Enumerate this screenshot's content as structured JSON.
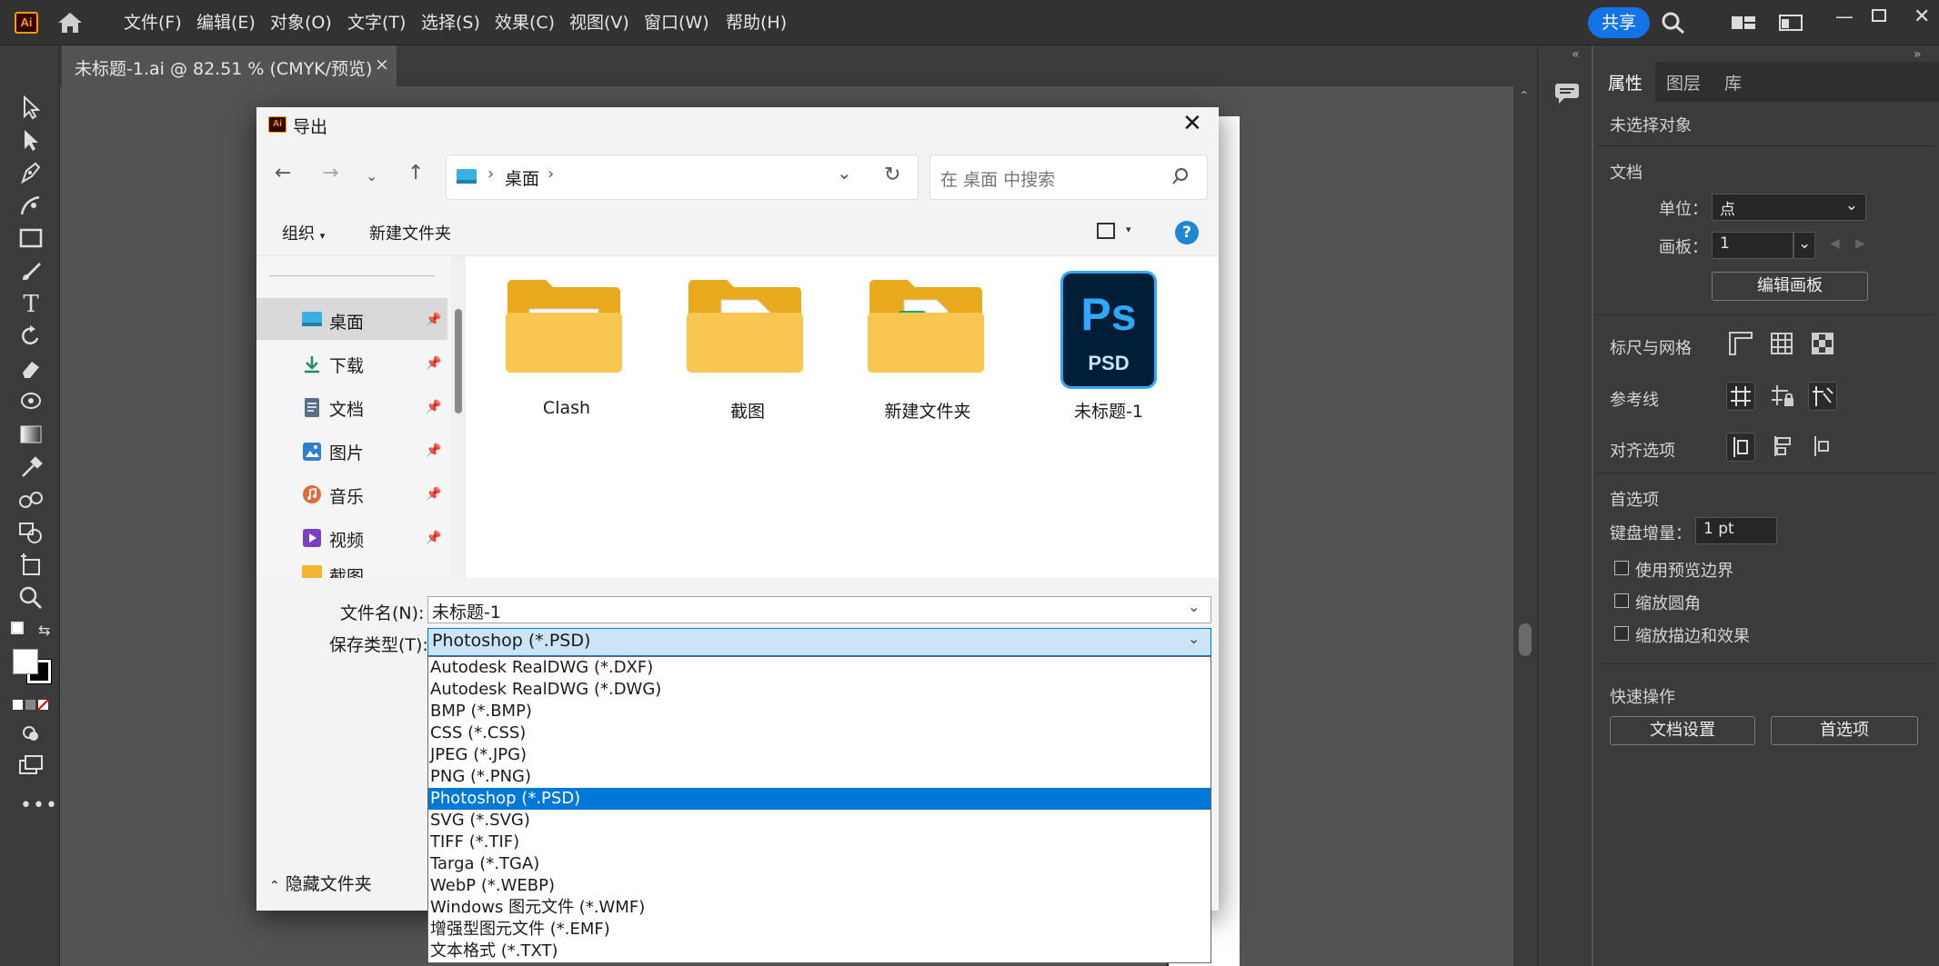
{
  "app": {
    "logo_text": "Ai",
    "menus": [
      "文件(F)",
      "编辑(E)",
      "对象(O)",
      "文字(T)",
      "选择(S)",
      "效果(C)",
      "视图(V)",
      "窗口(W)",
      "帮助(H)"
    ],
    "share_label": "共享"
  },
  "document_tab": {
    "title": "未标题-1.ai @ 82.51 % (CMYK/预览)",
    "close": "×"
  },
  "panel": {
    "tabs": [
      "属性",
      "图层",
      "库"
    ],
    "no_selection": "未选择对象",
    "document_section": "文档",
    "unit_label": "单位：",
    "unit_value": "点",
    "artboard_label": "画板：",
    "artboard_value": "1",
    "edit_artboard_button": "编辑画板",
    "rulers_grid": "标尺与网格",
    "guides": "参考线",
    "align_options": "对齐选项",
    "preferences_section": "首选项",
    "keyboard_increment_label": "键盘增量：",
    "keyboard_increment_value": "1 pt",
    "checkboxes": [
      "使用预览边界",
      "缩放圆角",
      "缩放描边和效果"
    ],
    "quick_actions": "快速操作",
    "doc_setup_button": "文档设置",
    "preferences_button": "首选项"
  },
  "dialog": {
    "title": "导出",
    "close": "✕",
    "breadcrumb": [
      "桌面"
    ],
    "search_placeholder": "在 桌面 中搜索",
    "organize": "组织",
    "new_folder": "新建文件夹",
    "help": "?",
    "nav_items": [
      {
        "label": "桌面",
        "icon": "desktop-icon",
        "color": "#3ab0e0"
      },
      {
        "label": "下载",
        "icon": "download-icon",
        "color": "#1e8f5a"
      },
      {
        "label": "文档",
        "icon": "document-icon",
        "color": "#5a6f86"
      },
      {
        "label": "图片",
        "icon": "picture-icon",
        "color": "#2d7fd1"
      },
      {
        "label": "音乐",
        "icon": "music-icon",
        "color": "#e06b3a"
      },
      {
        "label": "视频",
        "icon": "video-icon",
        "color": "#7b3fc4"
      },
      {
        "label": "截图",
        "icon": "folder-icon",
        "color": "#f2b632"
      }
    ],
    "files": [
      {
        "name": "Clash",
        "type": "folder"
      },
      {
        "name": "截图",
        "type": "folder"
      },
      {
        "name": "新建文件夹",
        "type": "folder"
      },
      {
        "name": "未标题-1",
        "type": "psd",
        "badge_top": "Ps",
        "badge_bottom": "PSD"
      }
    ],
    "filename_label": "文件名(N):",
    "filename_value": "未标题-1",
    "filetype_label": "保存类型(T):",
    "filetype_value": "Photoshop (*.PSD)",
    "filetype_options": [
      "Autodesk RealDWG (*.DXF)",
      "Autodesk RealDWG (*.DWG)",
      "BMP (*.BMP)",
      "CSS (*.CSS)",
      "JPEG (*.JPG)",
      "PNG (*.PNG)",
      "Photoshop (*.PSD)",
      "SVG (*.SVG)",
      "TIFF (*.TIF)",
      "Targa (*.TGA)",
      "WebP (*.WEBP)",
      "Windows 图元文件 (*.WMF)",
      "增强型图元文件 (*.EMF)",
      "文本格式 (*.TXT)"
    ],
    "selected_option": 6,
    "hide_folders": "隐藏文件夹"
  }
}
